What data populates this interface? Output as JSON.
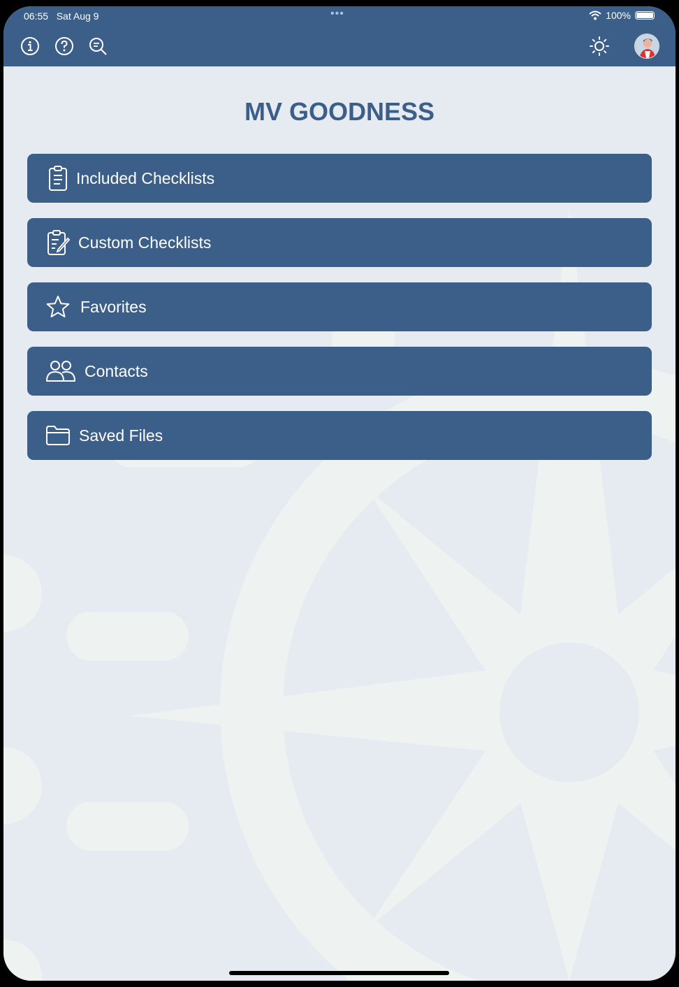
{
  "status_bar": {
    "time": "06:55",
    "date": "Sat Aug 9",
    "multitask_dots": "•••",
    "battery": "100%"
  },
  "toolbar": {
    "icons": [
      "info-icon",
      "help-icon",
      "search-icon",
      "brightness-icon",
      "avatar"
    ]
  },
  "page": {
    "title": "MV GOODNESS"
  },
  "menu": {
    "items": [
      {
        "label": "Included Checklists",
        "icon": "clipboard-icon"
      },
      {
        "label": "Custom Checklists",
        "icon": "clipboard-edit-icon"
      },
      {
        "label": "Favorites",
        "icon": "star-icon"
      },
      {
        "label": "Contacts",
        "icon": "people-icon"
      },
      {
        "label": "Saved Files",
        "icon": "folder-icon"
      }
    ]
  },
  "colors": {
    "primary": "#3c5f8a",
    "background": "#e6ebf1",
    "watermark": "#eef2f0"
  }
}
